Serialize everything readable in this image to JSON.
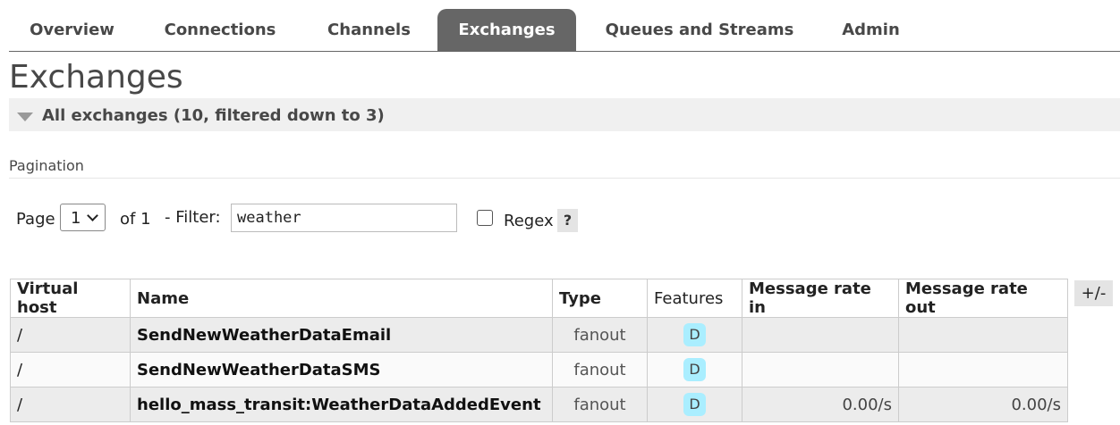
{
  "tabs": [
    "Overview",
    "Connections",
    "Channels",
    "Exchanges",
    "Queues and Streams",
    "Admin"
  ],
  "active_tab": "Exchanges",
  "page_title": "Exchanges",
  "section_label": "All exchanges (10, filtered down to 3)",
  "pagination": {
    "heading": "Pagination",
    "page_label": "Page",
    "page_value": "1",
    "of_label": "of 1",
    "filter_label": "- Filter:",
    "filter_value": "weather",
    "regex_label": "Regex",
    "regex_checked": false,
    "help_label": "?"
  },
  "table": {
    "columns": [
      "Virtual host",
      "Name",
      "Type",
      "Features",
      "Message rate in",
      "Message rate out"
    ],
    "toggle_label": "+/-",
    "rows": [
      {
        "vhost": "/",
        "name": "SendNewWeatherDataEmail",
        "type": "fanout",
        "feature": "D",
        "rate_in": "",
        "rate_out": ""
      },
      {
        "vhost": "/",
        "name": "SendNewWeatherDataSMS",
        "type": "fanout",
        "feature": "D",
        "rate_in": "",
        "rate_out": ""
      },
      {
        "vhost": "/",
        "name": "hello_mass_transit:WeatherDataAddedEvent",
        "type": "fanout",
        "feature": "D",
        "rate_in": "0.00/s",
        "rate_out": "0.00/s"
      }
    ]
  },
  "colors": {
    "active_tab_bg": "#666666",
    "feature_badge_bg": "#aaeeff",
    "row_odd": "#ececec",
    "row_even": "#fafafa"
  }
}
